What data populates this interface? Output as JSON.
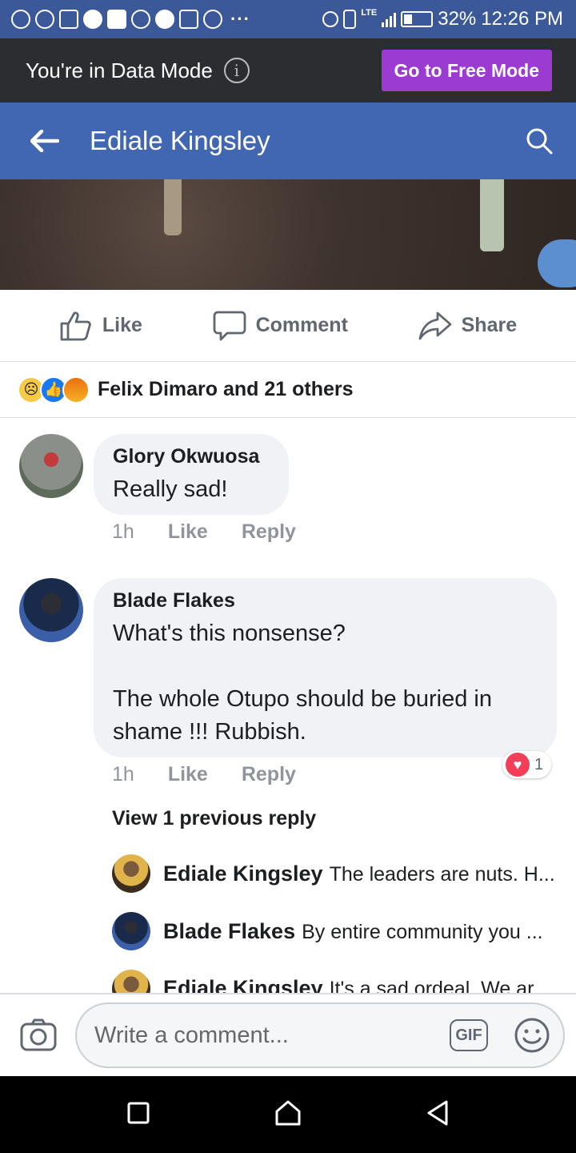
{
  "status_bar": {
    "network": "LTE",
    "battery": "32%",
    "time": "12:26 PM",
    "more": "···"
  },
  "data_mode": {
    "text": "You're in Data Mode",
    "info_icon": "i",
    "button": "Go to Free Mode"
  },
  "header": {
    "title": "Ediale Kingsley"
  },
  "actions": {
    "like": "Like",
    "comment": "Comment",
    "share": "Share"
  },
  "reactions": {
    "summary": "Felix Dimaro and 21 others",
    "icons": [
      "sad-icon",
      "like-icon",
      "angry-icon"
    ]
  },
  "comments": [
    {
      "name": "Glory Okwuosa",
      "text": "Really sad!",
      "time": "1h",
      "like": "Like",
      "reply": "Reply"
    },
    {
      "name": "Blade Flakes",
      "text": "What's this nonsense?\n\nThe whole Otupo should be buried in shame !!! Rubbish.",
      "time": "1h",
      "like": "Like",
      "reply": "Reply",
      "reaction_count": "1"
    }
  ],
  "view_previous": "View 1 previous reply",
  "replies": [
    {
      "name": "Ediale Kingsley",
      "text": "The leaders are nuts. H..."
    },
    {
      "name": "Blade Flakes",
      "text": "By entire community you ..."
    },
    {
      "name": "Ediale Kingsley",
      "text": "It's a sad ordeal. We ar..."
    }
  ],
  "composer": {
    "placeholder": "Write a comment...",
    "gif": "GIF"
  },
  "colors": {
    "facebook_blue": "#4267b2",
    "status_blue": "#3b5998",
    "free_mode_purple": "#9b3bd1"
  }
}
